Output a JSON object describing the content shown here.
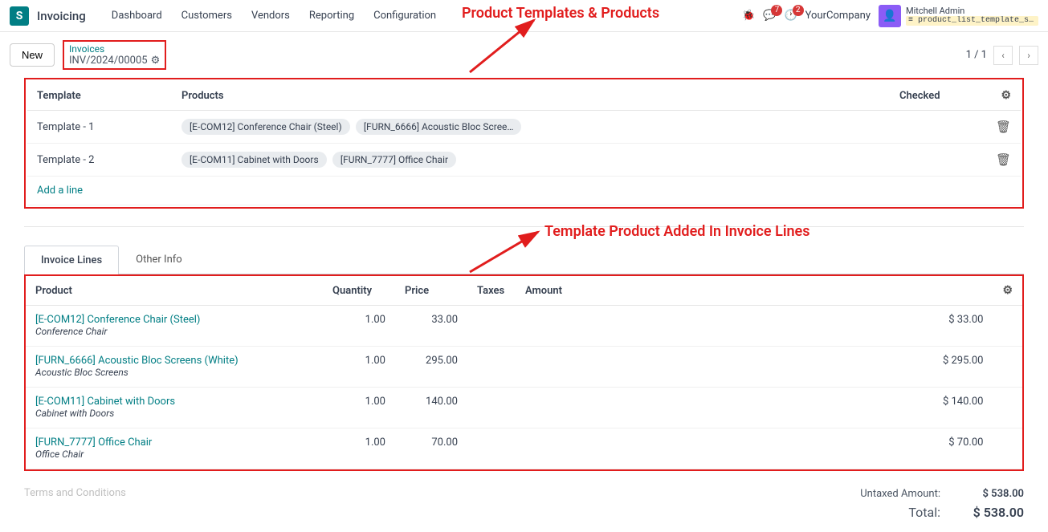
{
  "navbar": {
    "app": "Invoicing",
    "items": [
      "Dashboard",
      "Customers",
      "Vendors",
      "Reporting",
      "Configuration"
    ],
    "badge_chat": "7",
    "badge_clock": "2",
    "company": "YourCompany",
    "user": "Mitchell Admin",
    "db": "product_list_template_sa…"
  },
  "breadcrumb": {
    "new_btn": "New",
    "parent": "Invoices",
    "current": "INV/2024/00005",
    "pager": "1 / 1"
  },
  "annotation": {
    "top": "Product Templates & Products",
    "mid": "Template Product Added In Invoice Lines"
  },
  "templates": {
    "headers": {
      "template": "Template",
      "products": "Products",
      "checked": "Checked"
    },
    "rows": [
      {
        "name": "Template - 1",
        "products": [
          "[E-COM12] Conference Chair (Steel)",
          "[FURN_6666] Acoustic Bloc Scree…"
        ]
      },
      {
        "name": "Template - 2",
        "products": [
          "[E-COM11] Cabinet with Doors",
          "[FURN_7777] Office Chair"
        ]
      }
    ],
    "add": "Add a line"
  },
  "tabs": {
    "lines": "Invoice Lines",
    "other": "Other Info"
  },
  "lines": {
    "headers": {
      "product": "Product",
      "quantity": "Quantity",
      "price": "Price",
      "taxes": "Taxes",
      "amount": "Amount"
    },
    "rows": [
      {
        "product": "[E-COM12] Conference Chair (Steel)",
        "desc": "Conference Chair",
        "qty": "1.00",
        "price": "33.00",
        "amount": "$ 33.00"
      },
      {
        "product": "[FURN_6666] Acoustic Bloc Screens (White)",
        "desc": "Acoustic Bloc Screens",
        "qty": "1.00",
        "price": "295.00",
        "amount": "$ 295.00"
      },
      {
        "product": "[E-COM11] Cabinet with Doors",
        "desc": "Cabinet with Doors",
        "qty": "1.00",
        "price": "140.00",
        "amount": "$ 140.00"
      },
      {
        "product": "[FURN_7777] Office Chair",
        "desc": "Office Chair",
        "qty": "1.00",
        "price": "70.00",
        "amount": "$ 70.00"
      }
    ]
  },
  "footer": {
    "terms": "Terms and Conditions",
    "untaxed_label": "Untaxed Amount:",
    "untaxed_val": "$ 538.00",
    "total_label": "Total:",
    "total_val": "$ 538.00"
  }
}
